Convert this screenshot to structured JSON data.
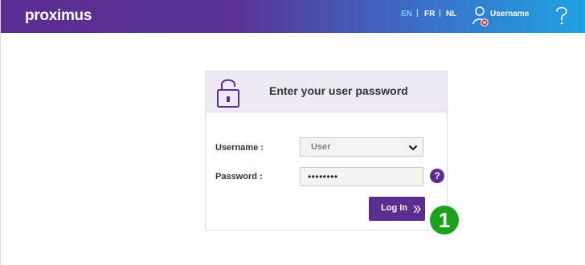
{
  "header": {
    "logo": "proximus",
    "languages": [
      {
        "code": "EN",
        "active": true
      },
      {
        "code": "FR",
        "active": false
      },
      {
        "code": "NL",
        "active": false
      }
    ],
    "separator": "|",
    "username": "Username",
    "help_symbol": "?",
    "user_icon": "user-error-icon",
    "help_icon": "question-mark-icon"
  },
  "login": {
    "title": "Enter your user password",
    "lock_icon": "padlock-icon",
    "username_label": "Username :",
    "username_value": "User",
    "password_label": "Password :",
    "password_value": "••••••••",
    "help_symbol": "?",
    "button_label": "Log In",
    "button_icon": "double-chevron-right-icon"
  },
  "annotation": {
    "step_number": "1",
    "color": "#1aa31a"
  },
  "colors": {
    "brand_purple": "#5c2d91",
    "header_end": "#1fa3e0",
    "active_language": "#6fd3ff",
    "card_header_bg": "#eee9f3"
  }
}
